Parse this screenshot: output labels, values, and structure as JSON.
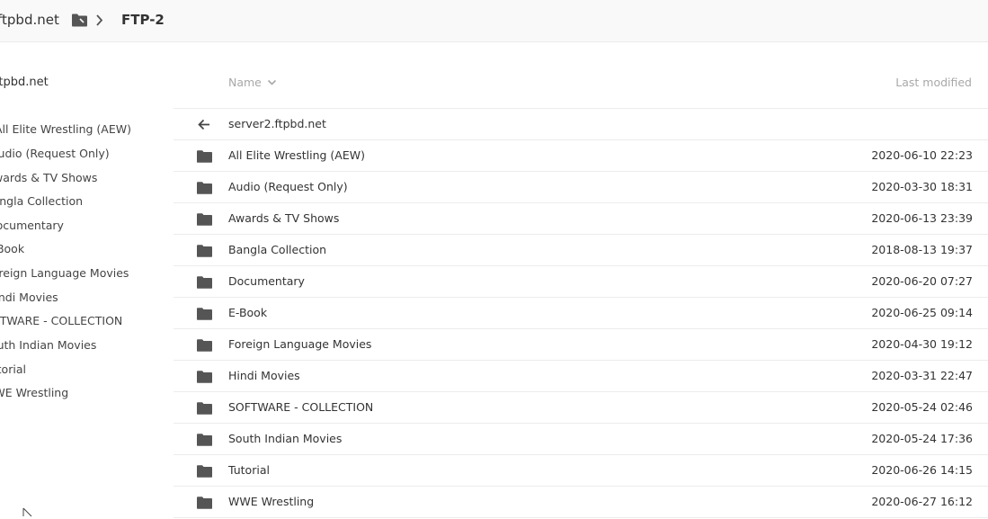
{
  "breadcrumb": {
    "host": "ftpbd.net",
    "folder_icon": "folder-icon",
    "separator_icon": "chevron-right-icon",
    "current": "FTP-2"
  },
  "sidebar": {
    "root": "ftpbd.net",
    "items": [
      {
        "label": "All Elite Wrestling (AEW)",
        "visible_label": "Elite Wrestling (AEW)"
      },
      {
        "label": "Audio (Request Only)",
        "visible_label": "io (Request Only)"
      },
      {
        "label": "Awards & TV Shows",
        "visible_label": "ards & TV Shows"
      },
      {
        "label": "Bangla Collection",
        "visible_label": "gla Collection"
      },
      {
        "label": "Documentary",
        "visible_label": "umentary"
      },
      {
        "label": "E-Book",
        "visible_label": "ook"
      },
      {
        "label": "Foreign Language Movies",
        "visible_label": "eign Language Movies"
      },
      {
        "label": "Hindi Movies",
        "visible_label": "di Movies"
      },
      {
        "label": "SOFTWARE - COLLECTION",
        "visible_label": "TWARE - COLLECTION"
      },
      {
        "label": "South Indian Movies",
        "visible_label": "th Indian Movies"
      },
      {
        "label": "Tutorial",
        "visible_label": "orial"
      },
      {
        "label": "WWE Wrestling",
        "visible_label": "E Wrestling"
      }
    ]
  },
  "table": {
    "columns": {
      "name": "Name",
      "modified": "Last modified"
    },
    "parent": {
      "label": "server2.ftpbd.net",
      "icon": "arrow-left-icon"
    },
    "rows": [
      {
        "name": "All Elite Wrestling (AEW)",
        "modified": "2020-06-10 22:23"
      },
      {
        "name": "Audio (Request Only)",
        "modified": "2020-03-30 18:31"
      },
      {
        "name": "Awards & TV Shows",
        "modified": "2020-06-13 23:39"
      },
      {
        "name": "Bangla Collection",
        "modified": "2018-08-13 19:37"
      },
      {
        "name": "Documentary",
        "modified": "2020-06-20 07:27"
      },
      {
        "name": "E-Book",
        "modified": "2020-06-25 09:14"
      },
      {
        "name": "Foreign Language Movies",
        "modified": "2020-04-30 19:12"
      },
      {
        "name": "Hindi Movies",
        "modified": "2020-03-31 22:47"
      },
      {
        "name": "SOFTWARE - COLLECTION",
        "modified": "2020-05-24 02:46"
      },
      {
        "name": "South Indian Movies",
        "modified": "2020-05-24 17:36"
      },
      {
        "name": "Tutorial",
        "modified": "2020-06-26 14:15"
      },
      {
        "name": "WWE Wrestling",
        "modified": "2020-06-27 16:12"
      }
    ]
  },
  "colors": {
    "header_bg": "#f9f9f9",
    "text": "#333333",
    "muted": "#a8a8a8",
    "icon": "#555555",
    "divider": "#ececec"
  }
}
